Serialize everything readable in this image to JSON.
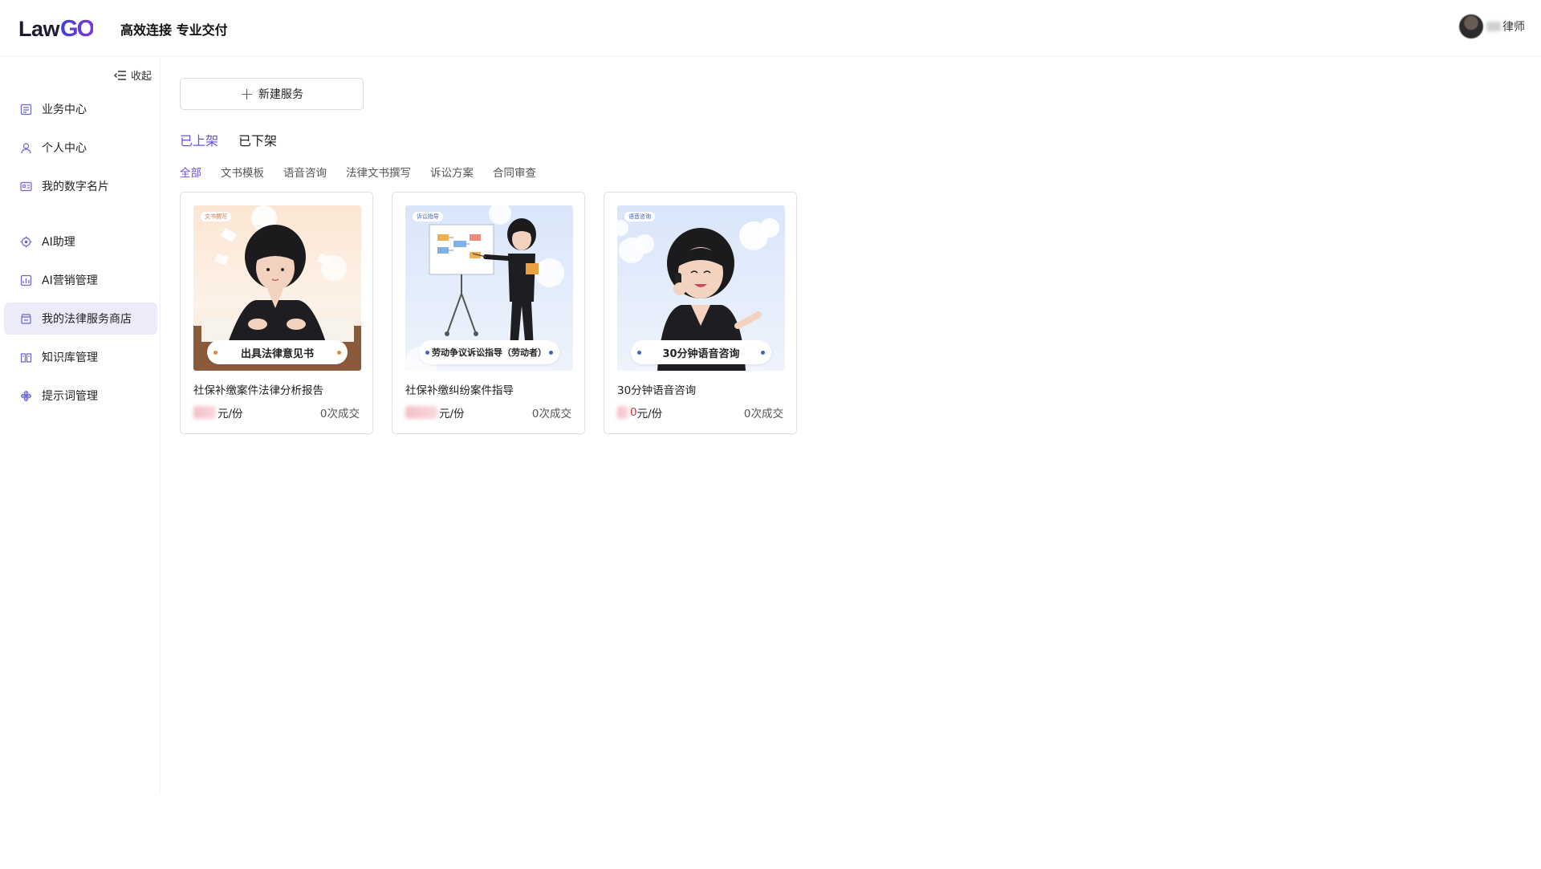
{
  "header": {
    "logo_left": "Law",
    "logo_right": "GO",
    "slogan": "高效连接 专业交付",
    "user_label": "律师"
  },
  "sidebar": {
    "collapse_label": "收起",
    "items": [
      {
        "label": "业务中心",
        "icon": "business-icon"
      },
      {
        "label": "个人中心",
        "icon": "person-icon"
      },
      {
        "label": "我的数字名片",
        "icon": "card-icon"
      },
      {
        "label": "AI助理",
        "icon": "ai-assistant-icon"
      },
      {
        "label": "AI营销管理",
        "icon": "marketing-icon"
      },
      {
        "label": "我的法律服务商店",
        "icon": "store-icon",
        "active": true
      },
      {
        "label": "知识库管理",
        "icon": "book-icon"
      },
      {
        "label": "提示词管理",
        "icon": "prompt-icon"
      }
    ]
  },
  "main": {
    "new_button": "新建服务",
    "status_tabs": [
      {
        "label": "已上架",
        "active": true
      },
      {
        "label": "已下架",
        "active": false
      }
    ],
    "category_tabs": [
      {
        "label": "全部",
        "active": true
      },
      {
        "label": "文书模板"
      },
      {
        "label": "语音咨询"
      },
      {
        "label": "法律文书撰写"
      },
      {
        "label": "诉讼方案"
      },
      {
        "label": "合同审查"
      }
    ],
    "cards": [
      {
        "tag": "文书撰写",
        "caption": "出具法律意见书",
        "title": "社保补缴案件法律分析报告",
        "price_visible": "元/份",
        "deals": "0次成交"
      },
      {
        "tag": "诉讼指导",
        "caption": "劳动争议诉讼指导（劳动者）",
        "title": "社保补缴纠纷案件指导",
        "price_visible": "元/份",
        "deals": "0次成交"
      },
      {
        "tag": "语音咨询",
        "caption": "30分钟语音咨询",
        "title": "30分钟语音咨询",
        "price_digit": "0",
        "price_visible": "元/份",
        "deals": "0次成交"
      }
    ]
  },
  "colors": {
    "accent": "#6c4fe0",
    "active_nav_bg": "#ecebfa",
    "price_red": "#d0303a"
  }
}
